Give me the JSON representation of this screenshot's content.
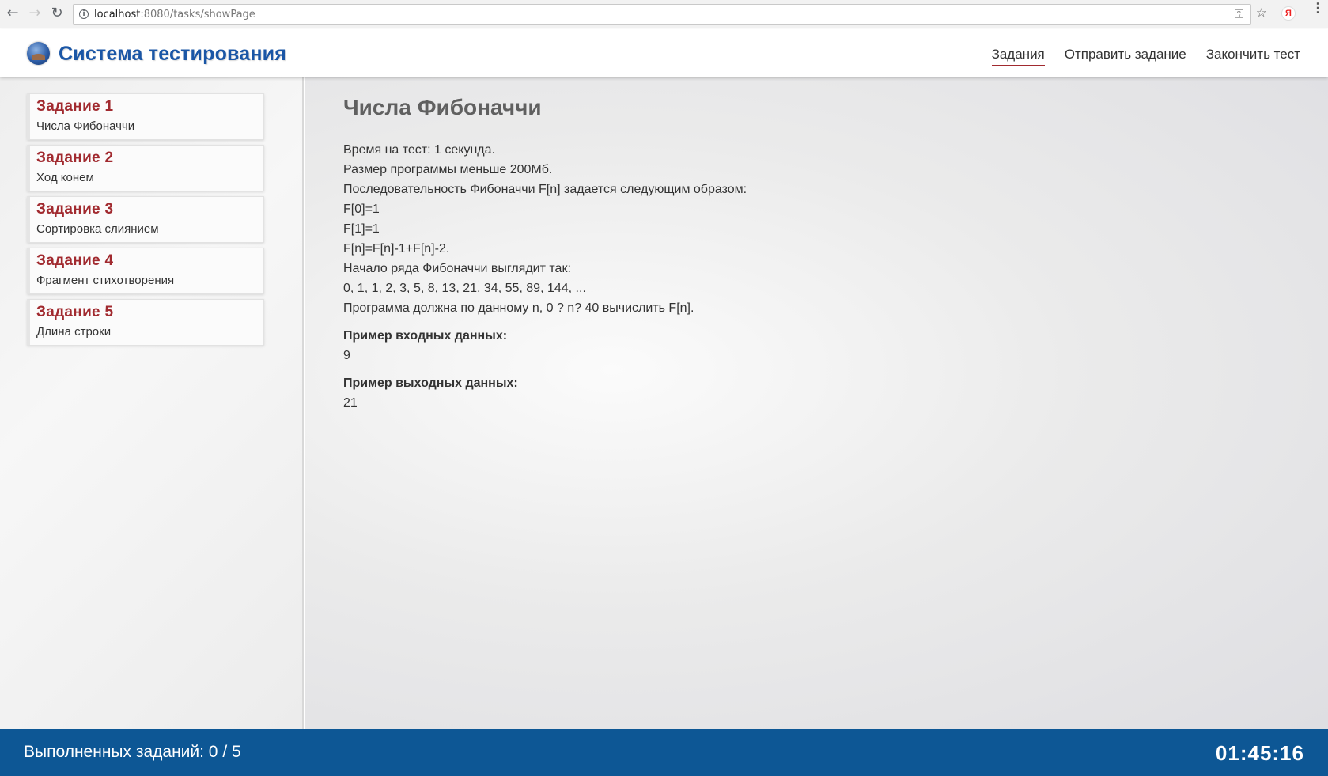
{
  "browser": {
    "url_host": "localhost",
    "url_rest": ":8080/tasks/showPage",
    "ext_label": "Я"
  },
  "header": {
    "app_title": "Система тестирования",
    "nav": [
      {
        "label": "Задания",
        "active": true
      },
      {
        "label": "Отправить задание",
        "active": false
      },
      {
        "label": "Закончить тест",
        "active": false
      }
    ]
  },
  "sidebar": {
    "tasks": [
      {
        "title": "Задание 1",
        "subtitle": "Числа Фибоначчи"
      },
      {
        "title": "Задание 2",
        "subtitle": "Ход конем"
      },
      {
        "title": "Задание 3",
        "subtitle": "Сортировка слиянием"
      },
      {
        "title": "Задание 4",
        "subtitle": "Фрагмент стихотворения"
      },
      {
        "title": "Задание 5",
        "subtitle": "Длина строки"
      }
    ]
  },
  "task": {
    "heading": "Числа Фибоначчи",
    "lines": [
      "Время на тест: 1 секунда.",
      "Размер программы меньше 200Мб.",
      "Последовательность Фибоначчи F[n] задается следующим образом:",
      "F[0]=1",
      "F[1]=1",
      "F[n]=F[n]-1+F[n]-2.",
      "Начало ряда Фибоначчи выглядит так:",
      "0, 1, 1, 2, 3, 5, 8, 13, 21, 34, 55, 89, 144, ...",
      "Программа должна по данному n, 0 ? n? 40 вычислить F[n]."
    ],
    "input_label": "Пример входных данных:",
    "input_value": "9",
    "output_label": "Пример выходных данных:",
    "output_value": "21"
  },
  "footer": {
    "progress": "Выполненных заданий: 0 / 5",
    "timer": "01:45:16"
  },
  "colors": {
    "brand_blue": "#1a56a6",
    "footer_blue": "#0d5795",
    "accent_red": "#a12a2f"
  }
}
